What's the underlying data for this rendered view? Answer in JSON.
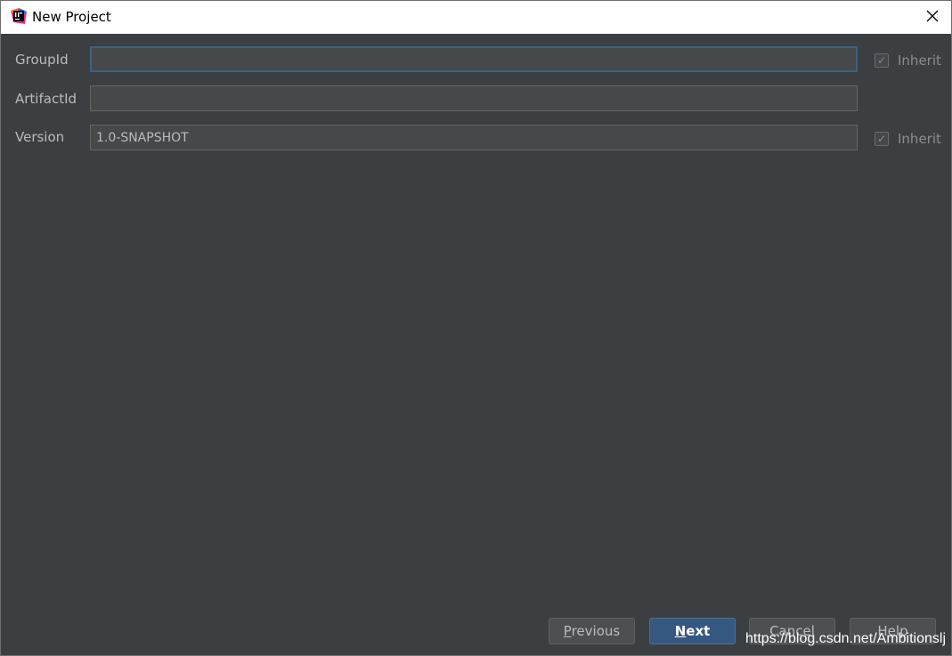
{
  "window": {
    "title": "New Project",
    "app_icon": "intellij-idea-icon",
    "close_icon": "close-icon"
  },
  "form": {
    "group_id": {
      "label": "GroupId",
      "value": "",
      "inherit_label": "Inherit",
      "inherit_checked": true
    },
    "artifact_id": {
      "label": "ArtifactId",
      "value": ""
    },
    "version": {
      "label": "Version",
      "value": "1.0-SNAPSHOT",
      "inherit_label": "Inherit",
      "inherit_checked": true
    }
  },
  "buttons": {
    "previous": {
      "mnemonic": "P",
      "rest": "revious"
    },
    "next": {
      "mnemonic": "N",
      "rest": "ext"
    },
    "cancel": "Cancel",
    "help": "Help"
  },
  "watermark": "https://blog.csdn.net/Ambitionslj",
  "colors": {
    "background": "#3c3f41",
    "field_background": "#45494a",
    "focus_border": "#3d6185",
    "primary_button": "#365880"
  }
}
